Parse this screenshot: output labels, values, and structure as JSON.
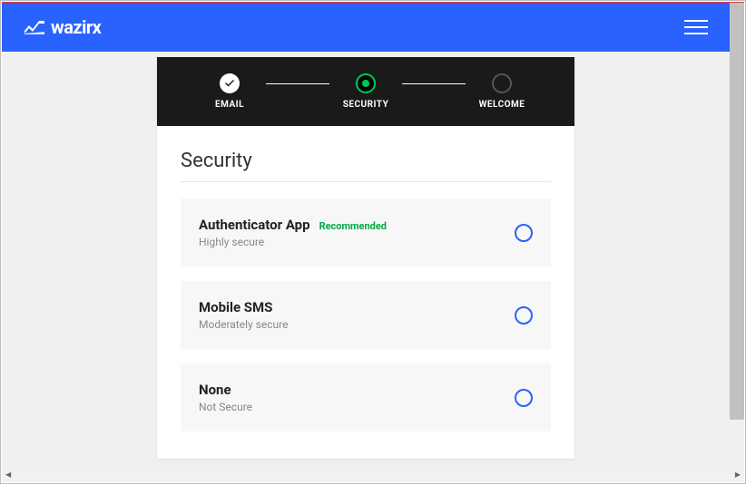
{
  "brand": {
    "name": "wazirx"
  },
  "stepper": {
    "steps": [
      {
        "label": "EMAIL",
        "state": "done"
      },
      {
        "label": "SECURITY",
        "state": "current"
      },
      {
        "label": "WELCOME",
        "state": "upcoming"
      }
    ]
  },
  "page": {
    "title": "Security"
  },
  "options": [
    {
      "title": "Authenticator App",
      "badge": "Recommended",
      "subtitle": "Highly secure"
    },
    {
      "title": "Mobile SMS",
      "badge": "",
      "subtitle": "Moderately secure"
    },
    {
      "title": "None",
      "badge": "",
      "subtitle": "Not Secure"
    }
  ],
  "colors": {
    "primary": "#2962ff",
    "success": "#00c853"
  }
}
